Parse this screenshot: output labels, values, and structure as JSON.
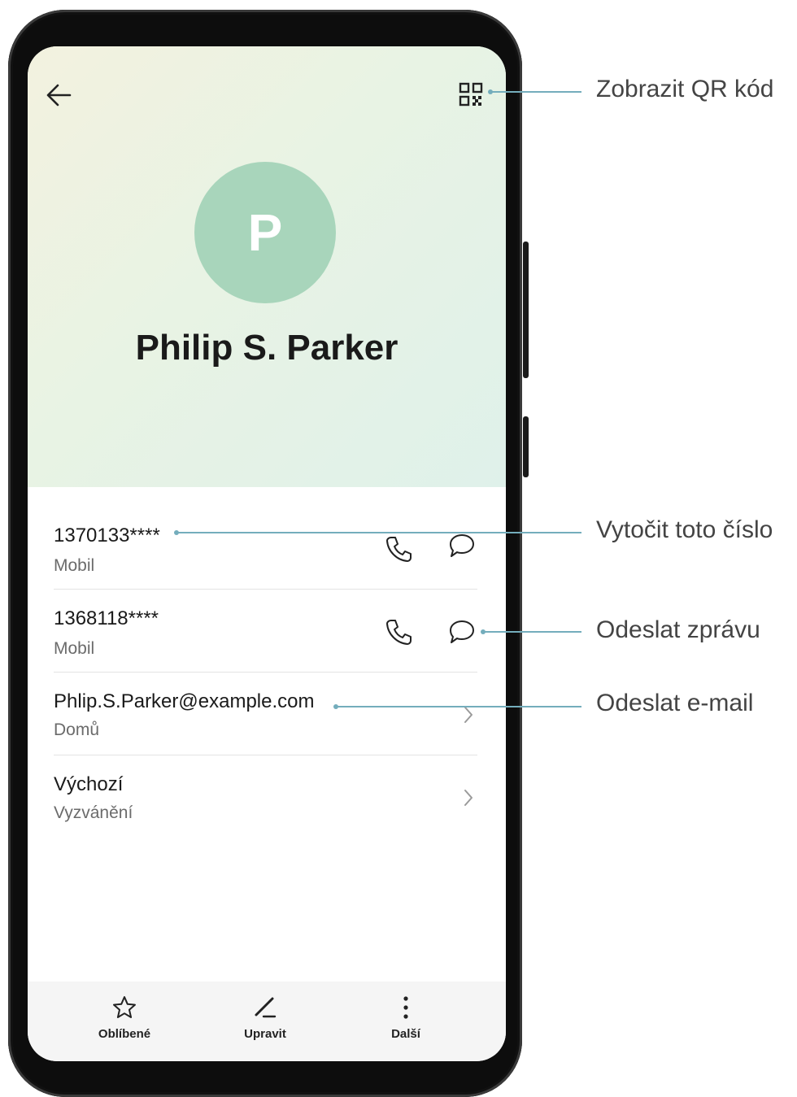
{
  "contact": {
    "avatar_initial": "P",
    "name": "Philip S. Parker"
  },
  "entries": [
    {
      "primary": "1370133****",
      "secondary": "Mobil"
    },
    {
      "primary": "1368118****",
      "secondary": "Mobil"
    },
    {
      "primary": "Phlip.S.Parker@example.com",
      "secondary": "Domů"
    },
    {
      "primary": "Výchozí",
      "secondary": "Vyzvánění"
    }
  ],
  "bottom_nav": [
    {
      "label": "Oblíbené",
      "icon": "star-icon"
    },
    {
      "label": "Upravit",
      "icon": "pencil-icon"
    },
    {
      "label": "Další",
      "icon": "more-vertical-icon"
    }
  ],
  "callouts": {
    "qr": "Zobrazit QR kód",
    "dial": "Vytočit toto číslo",
    "message": "Odeslat zprávu",
    "email": "Odeslat e-mail"
  },
  "colors": {
    "avatar_bg": "#a8d5bb",
    "callout_line": "#74adbc",
    "header_gradient_start": "#f3f2df",
    "header_gradient_end": "#dff1ea"
  }
}
